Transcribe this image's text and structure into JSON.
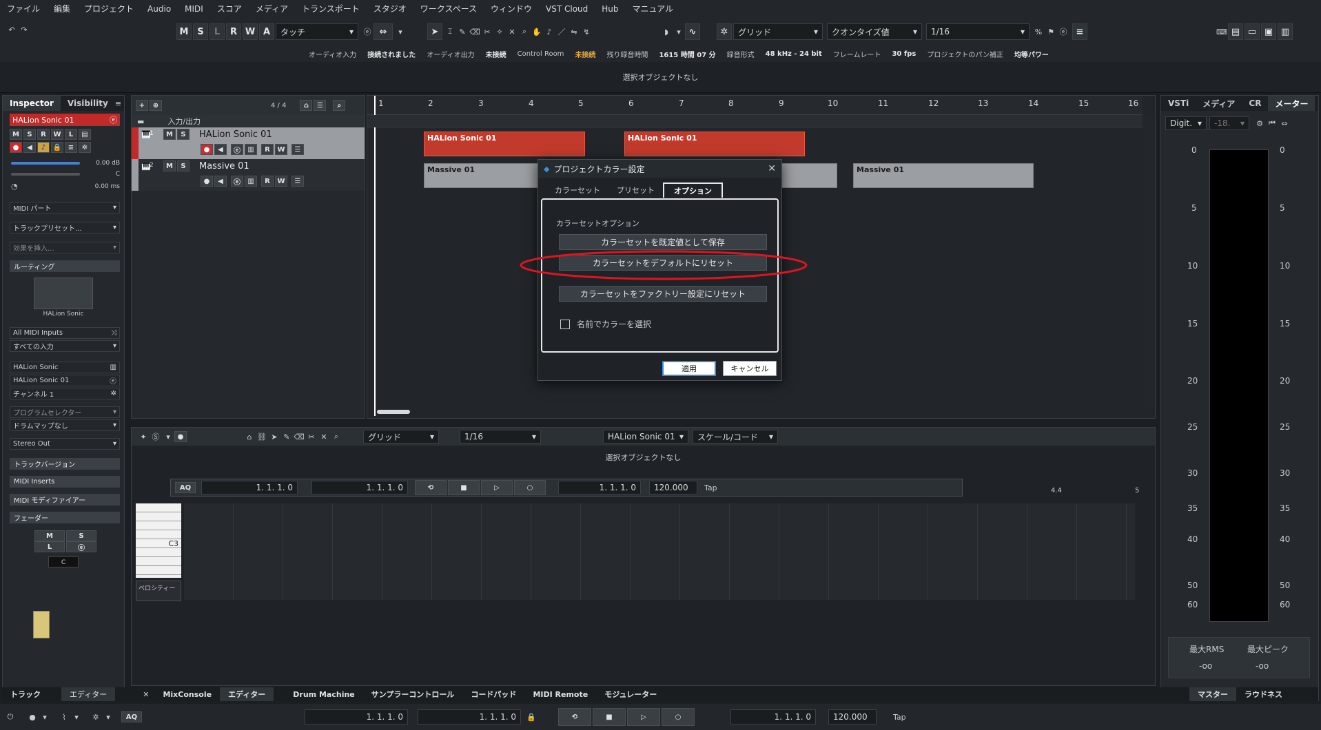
{
  "menu": [
    "ファイル",
    "編集",
    "プロジェクト",
    "Audio",
    "MIDI",
    "スコア",
    "メディア",
    "トランスポート",
    "スタジオ",
    "ワークスペース",
    "ウィンドウ",
    "VST Cloud",
    "Hub",
    "マニュアル"
  ],
  "toolbar": {
    "m": "M",
    "s": "S",
    "l": "L",
    "r": "R",
    "w": "W",
    "a": "A",
    "automation": "タッチ",
    "grid": "グリッド",
    "quantize_type": "クオンタイズ値",
    "quantize": "1/16"
  },
  "status": {
    "audio_in_label": "オーディオ入力",
    "audio_in_val": "接続されました",
    "audio_out_label": "オーディオ出力",
    "audio_out_val": "未接続",
    "control_room_label": "Control Room",
    "control_room_val": "未接続",
    "rec_time_label": "残り録音時間",
    "rec_time_val": "1615 時間 07 分",
    "rec_format_label": "録音形式",
    "rec_format_val": "48 kHz - 24 bit",
    "frame_label": "フレームレート",
    "frame_val": "30 fps",
    "pan_label": "プロジェクトのパン補正",
    "pan_val": "均等パワー"
  },
  "info_text": "選択オブジェクトなし",
  "inspector": {
    "tab1": "Inspector",
    "tab2": "Visibility",
    "track_name": "HALion Sonic 01",
    "volume": "0.00 dB",
    "pan": "C",
    "delay": "0.00 ms",
    "midi_part": "MIDI パート",
    "track_preset": "トラックプリセット...",
    "insert": "効果を挿入...",
    "routing": "ルーティング",
    "instrument": "HALion Sonic",
    "midi_in": "All MIDI Inputs",
    "all_in": "すべての入力",
    "out1": "HALion Sonic",
    "out2": "HALion Sonic 01",
    "channel": "チャンネル 1",
    "program_sel": "プログラムセレクター",
    "drum_map": "ドラムマップなし",
    "stereo_out": "Stereo Out",
    "track_versions": "トラックバージョン",
    "midi_inserts": "MIDI Inserts",
    "midi_modifiers": "MIDI モディファイアー",
    "fader": "フェーダー",
    "fader_m": "M",
    "fader_s": "S",
    "fader_l": "L",
    "fader_c": "C"
  },
  "tracklist": {
    "count": "4 / 4",
    "folder": "入力/出力",
    "tracks": [
      {
        "num": "1",
        "name": "HALion Sonic 01"
      },
      {
        "num": "2",
        "name": "Massive 01"
      }
    ]
  },
  "ruler": [
    "1",
    "2",
    "3",
    "4",
    "5",
    "6",
    "7",
    "8",
    "9",
    "10",
    "11",
    "12",
    "13",
    "14",
    "15",
    "16"
  ],
  "clips": {
    "h1": "HALion Sonic 01",
    "h2": "HALion Sonic 01",
    "m1": "Massive 01",
    "m2": "Massive 01"
  },
  "dialog": {
    "title": "プロジェクトカラー設定",
    "tabs": [
      "カラーセット",
      "プリセット",
      "オプション"
    ],
    "section": "カラーセットオプション",
    "btn1": "カラーセットを既定値として保存",
    "btn2": "カラーセットをデフォルトにリセット",
    "btn3": "カラーセットをファクトリー設定にリセット",
    "checkbox": "名前でカラーを選択",
    "apply": "適用",
    "cancel": "キャンセル"
  },
  "editor": {
    "grid": "グリッド",
    "quant": "1/16",
    "instrument": "HALion Sonic 01",
    "scale": "スケール/コード",
    "info": "選択オブジェクトなし",
    "c3": "C3",
    "velocity": "ベロシティー",
    "ruler_44": "4.4",
    "ruler_5": "5"
  },
  "transport_float": {
    "aq": "AQ",
    "pos1": "1. 1. 1.  0",
    "pos2": "1. 1. 1.  0",
    "pos3": "1. 1. 1.  0",
    "tempo": "120.000",
    "tap": "Tap"
  },
  "meter_panel": {
    "tabs": [
      "VSTi",
      "メディア",
      "CR",
      "メーター"
    ],
    "mode": "Digit.",
    "db": "-18.",
    "scale": [
      "0",
      "5",
      "10",
      "15",
      "20",
      "25",
      "30",
      "35",
      "40",
      "50",
      "60"
    ],
    "max_rms_label": "最大RMS",
    "max_peak_label": "最大ピーク",
    "max_rms": "-oo",
    "max_peak": "-oo",
    "bottom_tabs": [
      "マスター",
      "ラウドネス"
    ]
  },
  "lower_tabs": {
    "left": [
      "トラック",
      "エディター"
    ],
    "center": [
      "MixConsole",
      "エディター",
      "Drum Machine",
      "サンプラーコントロール",
      "コードパッド",
      "MIDI Remote",
      "モジュレーター"
    ]
  },
  "bottom_transport": {
    "aq": "AQ",
    "pos1": "1. 1. 1.  0",
    "pos2": "1. 1. 1.  0",
    "pos3": "1. 1. 1.  0",
    "tempo": "120.000",
    "tap": "Tap"
  },
  "colors": {
    "record": "#d8262a",
    "clip_red": "#c23a2c",
    "highlight_ellipse": "#e0141e",
    "warning": "#e6a83c"
  }
}
